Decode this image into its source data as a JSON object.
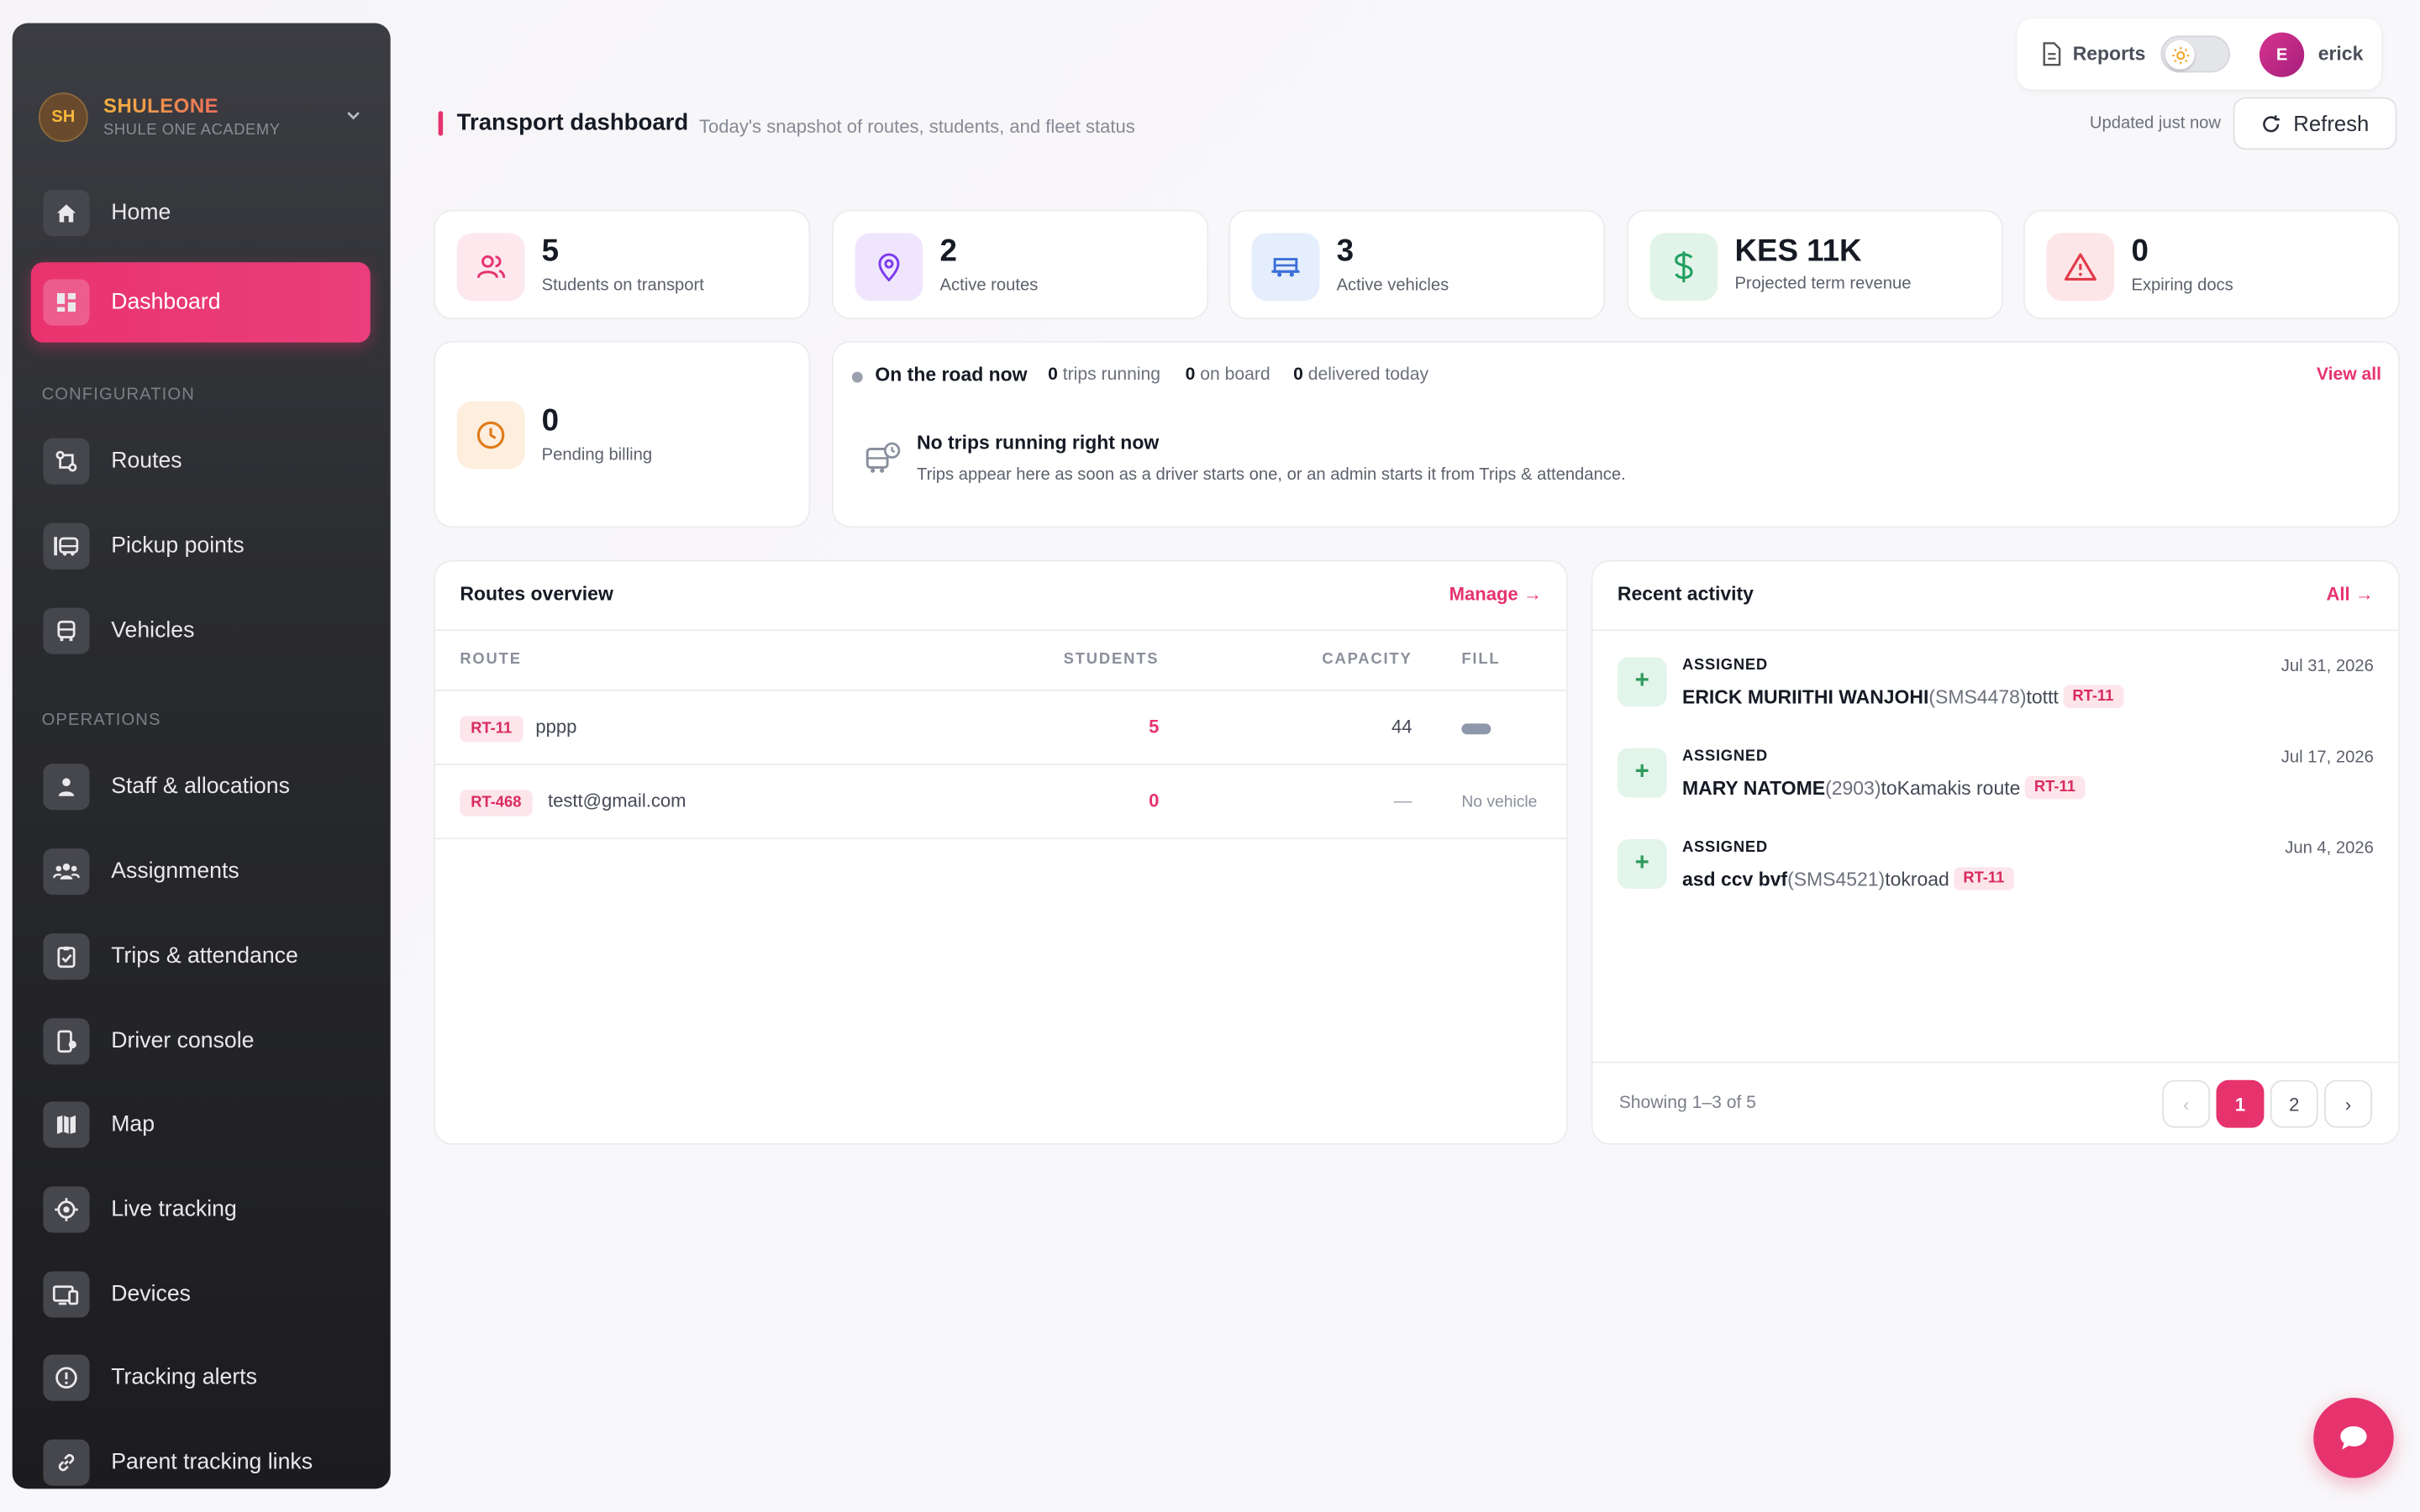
{
  "brand": {
    "initials": "SH",
    "name": "SHULEONE",
    "subtitle": "SHULE ONE ACADEMY"
  },
  "sidebar": {
    "items": [
      {
        "label": "Home",
        "icon": "home-icon"
      },
      {
        "label": "Dashboard",
        "icon": "dashboard-icon",
        "active": true
      }
    ],
    "configuration_label": "CONFIGURATION",
    "configuration": [
      {
        "label": "Routes",
        "icon": "route-icon"
      },
      {
        "label": "Pickup points",
        "icon": "bus-stop-icon"
      },
      {
        "label": "Vehicles",
        "icon": "bus-icon"
      }
    ],
    "operations_label": "OPERATIONS",
    "operations": [
      {
        "label": "Staff & allocations",
        "icon": "staff-icon"
      },
      {
        "label": "Assignments",
        "icon": "group-icon"
      },
      {
        "label": "Trips & attendance",
        "icon": "clipboard-check-icon"
      },
      {
        "label": "Driver console",
        "icon": "phone-location-icon"
      },
      {
        "label": "Map",
        "icon": "map-icon"
      },
      {
        "label": "Live tracking",
        "icon": "crosshair-icon"
      },
      {
        "label": "Devices",
        "icon": "devices-icon"
      },
      {
        "label": "Tracking alerts",
        "icon": "alert-circle-icon"
      },
      {
        "label": "Parent tracking links",
        "icon": "link-icon"
      }
    ]
  },
  "topbar": {
    "reports_label": "Reports",
    "user_initial": "E",
    "user_name": "erick"
  },
  "header": {
    "title": "Transport dashboard",
    "subtitle": "Today's snapshot of routes, students, and fleet status",
    "updated": "Updated just now",
    "refresh_label": "Refresh"
  },
  "stats": [
    {
      "value": "5",
      "label": "Students on transport",
      "icon": "users-icon",
      "color": "#e6336e"
    },
    {
      "value": "2",
      "label": "Active routes",
      "icon": "map-pin-icon",
      "color": "#7c3aed"
    },
    {
      "value": "3",
      "label": "Active vehicles",
      "icon": "van-icon",
      "color": "#3b6fd8"
    },
    {
      "value": "KES 11K",
      "label": "Projected term revenue",
      "icon": "dollar-icon",
      "color": "#22a060"
    },
    {
      "value": "0",
      "label": "Expiring docs",
      "icon": "warning-icon",
      "color": "#e23a4a"
    },
    {
      "value": "0",
      "label": "Pending billing",
      "icon": "clock-icon",
      "color": "#e07b1a"
    }
  ],
  "on_road": {
    "title": "On the road now",
    "trips_running": "0",
    "trips_running_label": "trips running",
    "on_board": "0",
    "on_board_label": "on board",
    "delivered": "0",
    "delivered_label": "delivered today",
    "view_all": "View all",
    "empty_title": "No trips running right now",
    "empty_sub": "Trips appear here as soon as a driver starts one, or an admin starts it from Trips & attendance."
  },
  "routes_overview": {
    "title": "Routes overview",
    "manage_label": "Manage →",
    "columns": [
      "ROUTE",
      "STUDENTS",
      "CAPACITY",
      "FILL"
    ],
    "rows": [
      {
        "code": "RT-11",
        "name": "pppp",
        "students": "5",
        "capacity": "44",
        "fill": 0.11
      },
      {
        "code": "RT-468",
        "name": "testt@gmail.com",
        "students": "0",
        "capacity": "—",
        "fill_label": "No vehicle"
      }
    ]
  },
  "activity": {
    "title": "Recent activity",
    "all_label": "All →",
    "items": [
      {
        "type": "ASSIGNED",
        "date": "Jul 31, 2026",
        "name": "ERICK MURIITHI WANJOHI",
        "id": "(SMS4478)",
        "to": "tottt",
        "route": "RT-11"
      },
      {
        "type": "ASSIGNED",
        "date": "Jul 17, 2026",
        "name": "MARY NATOME",
        "id": "(2903)",
        "to": "toKamakis route",
        "route": "RT-11"
      },
      {
        "type": "ASSIGNED",
        "date": "Jun 4, 2026",
        "name": "asd ccv bvf",
        "id": "(SMS4521)",
        "to": "tokroad",
        "route": "RT-11"
      }
    ],
    "showing": "Showing 1–3 of 5",
    "pages": [
      "1",
      "2"
    ],
    "prev": "‹",
    "next": "›"
  }
}
